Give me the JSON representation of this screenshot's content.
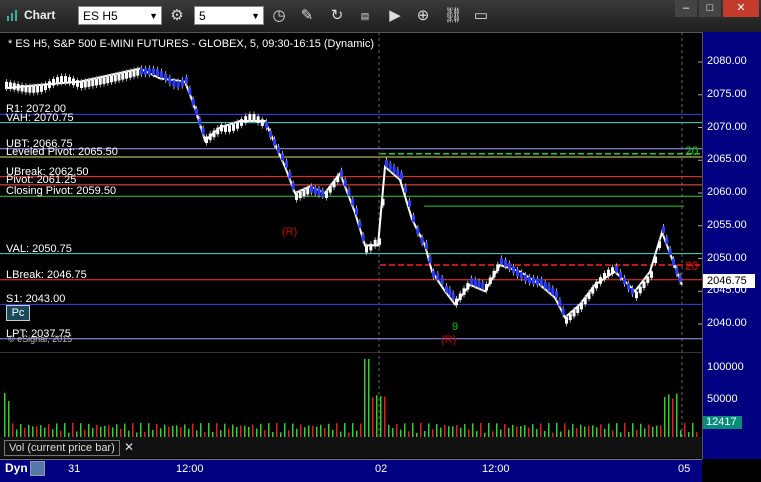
{
  "window": {
    "title": "Chart",
    "min": "–",
    "max": "□",
    "close": "✕"
  },
  "toolbar": {
    "symbol": "ES H5",
    "interval": "5"
  },
  "chart": {
    "header": "* ES H5, S&P 500 E-MINI FUTURES - GLOBEX, 5, 09:30-16:15 (Dynamic)",
    "copyright": "© eSignal, 2015",
    "levels": [
      {
        "label": "R1: 2072.00",
        "price": 2072.0,
        "color": "#3c3cff"
      },
      {
        "label": "VAH: 2070.75",
        "price": 2070.75,
        "color": "#40e0d0"
      },
      {
        "label": "UBT: 2066.75",
        "price": 2066.75,
        "color": "#9d9dff"
      },
      {
        "label": "Leveled Pivot: 2065.50",
        "price": 2065.5,
        "color": "#e0e060"
      },
      {
        "label": "UBreak: 2062.50",
        "price": 2062.5,
        "color": "#ff3030"
      },
      {
        "label": "Pivot: 2061.25",
        "price": 2061.25,
        "color": "#ff5050"
      },
      {
        "label": "Closing Pivot: 2059.50",
        "price": 2059.5,
        "color": "#30d030"
      },
      {
        "label": "VAL: 2050.75",
        "price": 2050.75,
        "color": "#40e0d0"
      },
      {
        "label": "LBreak: 2046.75",
        "price": 2046.75,
        "color": "#ff3030"
      },
      {
        "label": "S1: 2043.00",
        "price": 2043.0,
        "color": "#3c3cff"
      },
      {
        "label": "LPT: 2037.75",
        "price": 2037.75,
        "color": "#9d9dff"
      }
    ],
    "price_labels": [
      "2080.00",
      "2075.00",
      "2070.00",
      "2065.00",
      "2060.00",
      "2055.00",
      "2050.00",
      "2045.00",
      "2040.00"
    ],
    "last_price": "2046.75",
    "volume_labels": [
      "100000",
      "50000"
    ],
    "last_volume": "12417",
    "volume_legend": "Vol (current price bar)",
    "x_labels": [
      "31",
      "12:00",
      "02",
      "12:00",
      "05"
    ],
    "pc_label": "Pc",
    "dyn_label": "Dyn",
    "markers": {
      "r1": "(R)",
      "r2": "(R)",
      "n20a": "20",
      "n20b": "20",
      "n9": "9"
    }
  }
}
